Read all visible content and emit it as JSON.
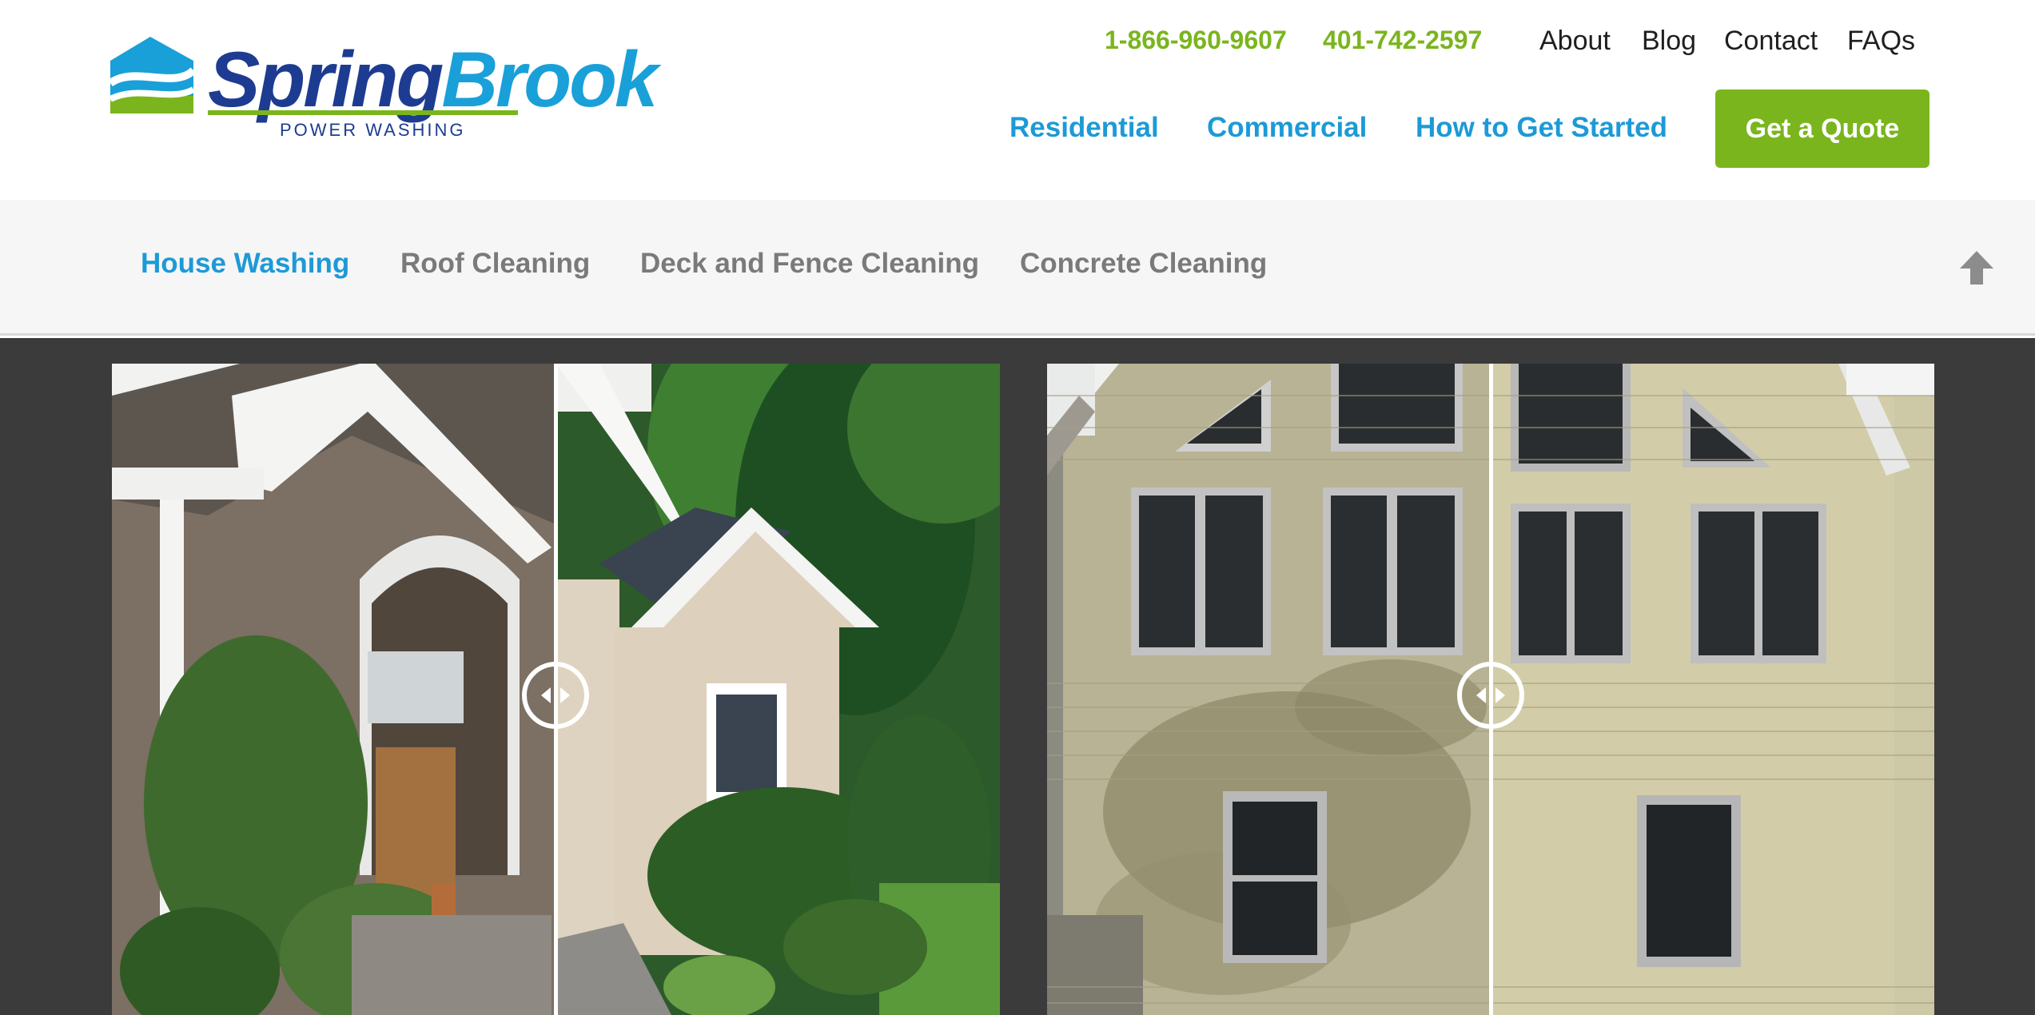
{
  "brand": {
    "name_part1": "Spring",
    "name_part2": "Brook",
    "tagline": "POWER WASHING",
    "colors": {
      "navy": "#1d3c91",
      "blue": "#1d9ad6",
      "green": "#7ab51d"
    }
  },
  "header": {
    "phones": [
      "1-866-960-9607",
      "401-742-2597"
    ],
    "utility_links": [
      "About",
      "Blog",
      "Contact",
      "FAQs"
    ],
    "main_nav": [
      "Residential",
      "Commercial",
      "How to Get Started"
    ],
    "cta": "Get a Quote"
  },
  "subnav": {
    "items": [
      "House Washing",
      "Roof Cleaning",
      "Deck and Fence Cleaning",
      "Concrete Cleaning"
    ],
    "active_index": 0,
    "scroll_top_icon": "arrow-up-icon"
  },
  "gallery": {
    "comparisons": [
      {
        "subject": "shingle-house-front",
        "slider_position": 0.5
      },
      {
        "subject": "siding-house-gable",
        "slider_position": 0.5
      }
    ],
    "handle_icon": "left-right-arrows-icon"
  }
}
